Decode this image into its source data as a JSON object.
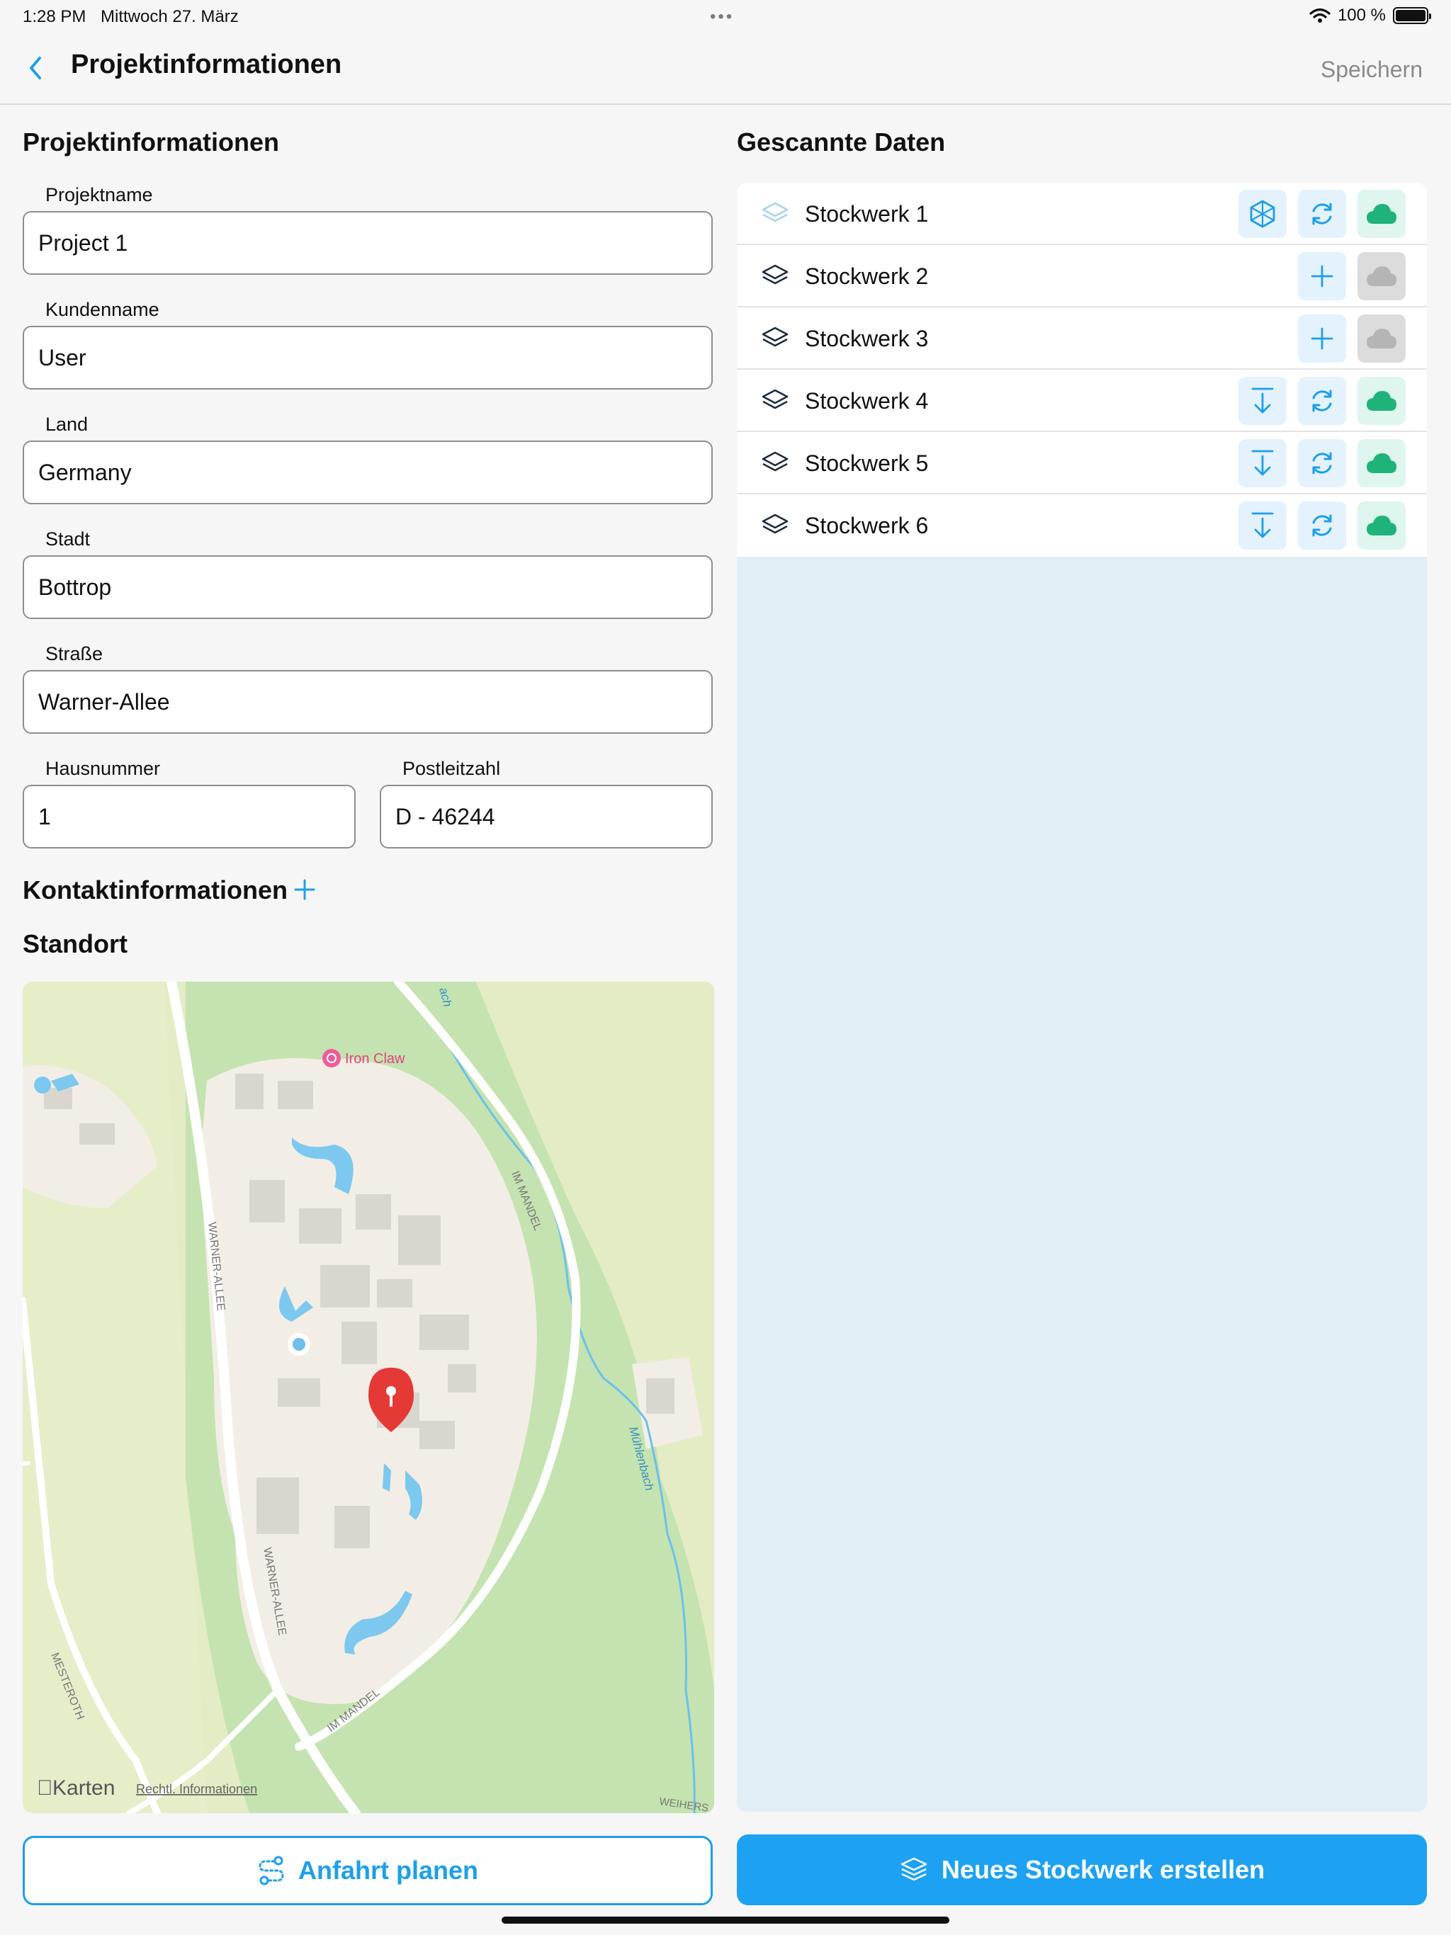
{
  "status": {
    "time": "1:28 PM",
    "date": "Mittwoch 27. März",
    "battery": "100 %"
  },
  "nav": {
    "title": "Projektinformationen",
    "save_label": "Speichern"
  },
  "form": {
    "section_title": "Projektinformationen",
    "fields": {
      "projektname": {
        "label": "Projektname",
        "value": "Project 1"
      },
      "kundenname": {
        "label": "Kundenname",
        "value": "User"
      },
      "land": {
        "label": "Land",
        "value": "Germany"
      },
      "stadt": {
        "label": "Stadt",
        "value": "Bottrop"
      },
      "strasse": {
        "label": "Straße",
        "value": "Warner-Allee"
      },
      "hausnummer": {
        "label": "Hausnummer",
        "value": "1"
      },
      "postleitzahl": {
        "label": "Postleitzahl",
        "value": "D - 46244"
      }
    },
    "contact_title": "Kontaktinformationen",
    "location_title": "Standort"
  },
  "map": {
    "poi": "Iron Claw",
    "roads": [
      "WARNER-ALLEE",
      "IM MANDEL",
      "MESTEROTH",
      "WEIHERS"
    ],
    "stream": "Mühlenbach",
    "stream_top": "ach",
    "brand": "Karten",
    "legal": "Rechtl. Informationen",
    "colors": {
      "park": "#c4e3b0",
      "field": "#e3ecc4",
      "built": "#f2eee6",
      "water": "#7cc8ee",
      "road": "#ffffff",
      "pin": "#e53935"
    }
  },
  "scanned": {
    "title": "Gescannte Daten",
    "floors": [
      {
        "name": "Stockwerk 1",
        "state": "scanned"
      },
      {
        "name": "Stockwerk 2",
        "state": "empty"
      },
      {
        "name": "Stockwerk 3",
        "state": "empty"
      },
      {
        "name": "Stockwerk 4",
        "state": "cloud"
      },
      {
        "name": "Stockwerk 5",
        "state": "cloud"
      },
      {
        "name": "Stockwerk 6",
        "state": "cloud"
      }
    ]
  },
  "buttons": {
    "route": "Anfahrt planen",
    "new_floor": "Neues Stockwerk erstellen"
  },
  "colors": {
    "accent": "#1da1f2",
    "cloud_green": "#1fb37a",
    "panel_bg": "#e1eef5"
  }
}
